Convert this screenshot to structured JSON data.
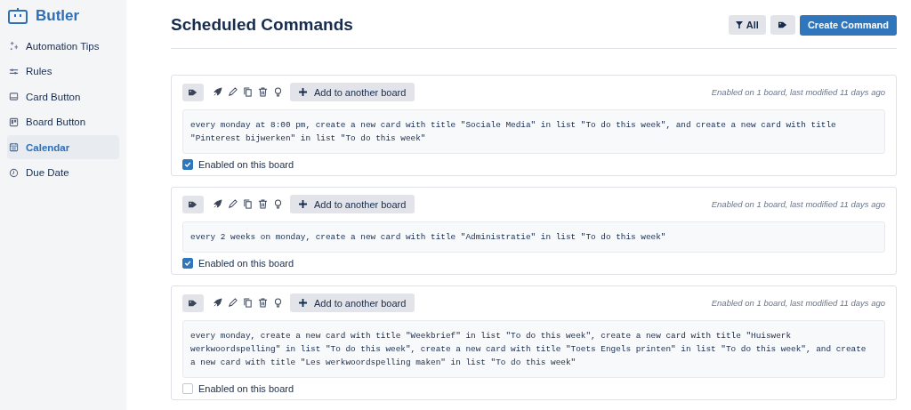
{
  "sidebar": {
    "title": "Butler",
    "items": [
      {
        "label": "Automation Tips",
        "selected": false
      },
      {
        "label": "Rules",
        "selected": false
      },
      {
        "label": "Card Button",
        "selected": false
      },
      {
        "label": "Board Button",
        "selected": false
      },
      {
        "label": "Calendar",
        "selected": true
      },
      {
        "label": "Due Date",
        "selected": false
      }
    ]
  },
  "header": {
    "title": "Scheduled Commands",
    "filter_label": "All",
    "create_label": "Create Command"
  },
  "commands": [
    {
      "add_label": "Add to another board",
      "meta": "Enabled on 1 board, last modified 11 days ago",
      "text": "every monday at 8:00 pm, create a new card with title \"Sociale Media\" in list \"To do this week\", and create a new card with title \"Pinterest bijwerken\" in list \"To do this week\"",
      "enabled_label": "Enabled on this board",
      "checked": true
    },
    {
      "add_label": "Add to another board",
      "meta": "Enabled on 1 board, last modified 11 days ago",
      "text": "every 2 weeks on monday, create a new card with title \"Administratie\" in list \"To do this week\"",
      "enabled_label": "Enabled on this board",
      "checked": true
    },
    {
      "add_label": "Add to another board",
      "meta": "Enabled on 1 board, last modified 11 days ago",
      "text": "every monday, create a new card with title \"Weekbrief\" in list \"To do this week\", create a new card with title \"Huiswerk werkwoordspelling\" in list \"To do this week\", create a new card with title \"Toets Engels printen\" in list \"To do this week\", and create a new card with title \"Les werkwoordspelling maken\" in list \"To do this week\"",
      "enabled_label": "Enabled on this board",
      "checked": false
    }
  ]
}
